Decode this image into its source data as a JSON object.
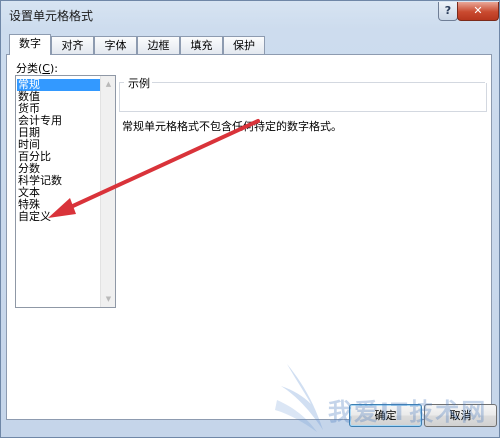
{
  "window": {
    "title": "设置单元格格式",
    "help_glyph": "?",
    "close_glyph": "✕"
  },
  "tabs": [
    "数字",
    "对齐",
    "字体",
    "边框",
    "填充",
    "保护"
  ],
  "category": {
    "label": "分类",
    "label_hotkey_prefix": "(",
    "label_hotkey": "C",
    "label_hotkey_suffix": "):",
    "items": [
      "常规",
      "数值",
      "货币",
      "会计专用",
      "日期",
      "时间",
      "百分比",
      "分数",
      "科学记数",
      "文本",
      "特殊",
      "自定义"
    ],
    "selected": "常规"
  },
  "sample": {
    "label": "示例"
  },
  "description": "常规单元格格式不包含任何特定的数字格式。",
  "buttons": {
    "ok": "确定",
    "cancel": "取消"
  },
  "watermark": {
    "text": "我爱IT技术网"
  },
  "colors": {
    "selection": "#3399ff",
    "annotation_arrow": "#d9333a"
  }
}
